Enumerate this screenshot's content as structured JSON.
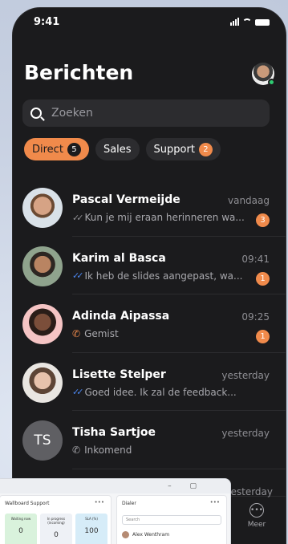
{
  "status_bar": {
    "time": "9:41"
  },
  "header": {
    "title": "Berichten"
  },
  "search": {
    "placeholder": "Zoeken"
  },
  "filters": [
    {
      "label": "Direct",
      "badge": "5",
      "active": true
    },
    {
      "label": "Sales",
      "badge": "",
      "active": false
    },
    {
      "label": "Support",
      "badge": "2",
      "active": false
    }
  ],
  "conversations": [
    {
      "name": "Pascal Vermeijde",
      "time": "vandaag",
      "preview": "Kun je mij eraan herinneren wa...",
      "status": "read-grey",
      "unread": "3"
    },
    {
      "name": "Karim al Basca",
      "time": "09:41",
      "preview": "Ik heb de slides aangepast, wa...",
      "status": "read-blue",
      "unread": "1"
    },
    {
      "name": "Adinda Aipassa",
      "time": "09:25",
      "preview": "Gemist",
      "status": "missed-call",
      "unread": "1"
    },
    {
      "name": "Lisette Stelper",
      "time": "yesterday",
      "preview": "Goed idee. Ik zal de feedback...",
      "status": "read-blue",
      "unread": ""
    },
    {
      "name": "Tisha Sartjoe",
      "initials": "TS",
      "time": "yesterday",
      "preview": "Inkomend",
      "status": "incoming-call",
      "unread": ""
    }
  ],
  "peek_row_time": "yesterday",
  "bottom_nav": {
    "more_label": "Meer"
  },
  "desktop_window": {
    "left_panel": {
      "title": "Wallboard Support",
      "tiles": [
        {
          "label": "Waiting now",
          "value": "0"
        },
        {
          "label": "In progress (incoming)",
          "value": "0"
        },
        {
          "label": "SLA (%)",
          "value": "100"
        }
      ]
    },
    "right_panel": {
      "title": "Dialer",
      "search_placeholder": "Search",
      "contact": "Alex Wenthram"
    }
  },
  "colors": {
    "accent": "#f08a4b",
    "background": "#1b1b1d",
    "read_blue": "#4b86f0"
  }
}
